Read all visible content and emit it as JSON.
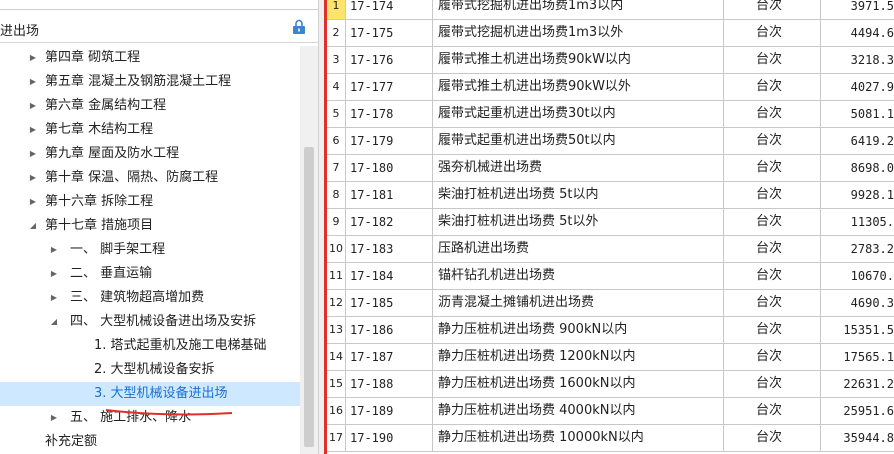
{
  "left_panel": {
    "header_title": "进出场",
    "tree": [
      {
        "label": "第四章 砌筑工程",
        "arrow": "▶"
      },
      {
        "label": "第五章 混凝土及钢筋混凝土工程",
        "arrow": "▶"
      },
      {
        "label": "第六章 金属结构工程",
        "arrow": "▶"
      },
      {
        "label": "第七章 木结构工程",
        "arrow": "▶"
      },
      {
        "label": "第九章 屋面及防水工程",
        "arrow": "▶"
      },
      {
        "label": "第十章 保温、隔热、防腐工程",
        "arrow": "▶"
      },
      {
        "label": "第十六章 拆除工程",
        "arrow": "▶"
      },
      {
        "label": "第十七章 措施项目",
        "arrow": "◢"
      },
      {
        "label": "一、 脚手架工程",
        "arrow": "▶"
      },
      {
        "label": "二、 垂直运输",
        "arrow": "▶"
      },
      {
        "label": "三、 建筑物超高增加费",
        "arrow": "▶"
      },
      {
        "label": "四、 大型机械设备进出场及安拆",
        "arrow": "◢"
      },
      {
        "label": "1. 塔式起重机及施工电梯基础",
        "arrow": ""
      },
      {
        "label": "2. 大型机械设备安拆",
        "arrow": ""
      },
      {
        "label": "3. 大型机械设备进出场",
        "arrow": ""
      },
      {
        "label": "五、 施工排水、降水",
        "arrow": "▶"
      },
      {
        "label": "补充定额",
        "arrow": ""
      }
    ]
  },
  "table": {
    "rows": [
      {
        "idx": "1",
        "code": "17-174",
        "name": "履带式挖掘机进出场费1m3以内",
        "unit": "台次",
        "price": "3971.5"
      },
      {
        "idx": "2",
        "code": "17-175",
        "name": "履带式挖掘机进出场费1m3以外",
        "unit": "台次",
        "price": "4494.6"
      },
      {
        "idx": "3",
        "code": "17-176",
        "name": "履带式推土机进出场费90kW以内",
        "unit": "台次",
        "price": "3218.3"
      },
      {
        "idx": "4",
        "code": "17-177",
        "name": "履带式推土机进出场费90kW以外",
        "unit": "台次",
        "price": "4027.9"
      },
      {
        "idx": "5",
        "code": "17-178",
        "name": "履带式起重机进出场费30t以内",
        "unit": "台次",
        "price": "5081.1"
      },
      {
        "idx": "6",
        "code": "17-179",
        "name": "履带式起重机进出场费50t以内",
        "unit": "台次",
        "price": "6419.2"
      },
      {
        "idx": "7",
        "code": "17-180",
        "name": "强夯机械进出场费",
        "unit": "台次",
        "price": "8698.0"
      },
      {
        "idx": "8",
        "code": "17-181",
        "name": "柴油打桩机进出场费 5t以内",
        "unit": "台次",
        "price": "9928.1"
      },
      {
        "idx": "9",
        "code": "17-182",
        "name": "柴油打桩机进出场费 5t以外",
        "unit": "台次",
        "price": "11305."
      },
      {
        "idx": "10",
        "code": "17-183",
        "name": "压路机进出场费",
        "unit": "台次",
        "price": "2783.2"
      },
      {
        "idx": "11",
        "code": "17-184",
        "name": "锚杆钻孔机进出场费",
        "unit": "台次",
        "price": "10670."
      },
      {
        "idx": "12",
        "code": "17-185",
        "name": "沥青混凝土摊铺机进出场费",
        "unit": "台次",
        "price": "4690.3"
      },
      {
        "idx": "13",
        "code": "17-186",
        "name": "静力压桩机进出场费 900kN以内",
        "unit": "台次",
        "price": "15351.5"
      },
      {
        "idx": "14",
        "code": "17-187",
        "name": "静力压桩机进出场费 1200kN以内",
        "unit": "台次",
        "price": "17565.1"
      },
      {
        "idx": "15",
        "code": "17-188",
        "name": "静力压桩机进出场费 1600kN以内",
        "unit": "台次",
        "price": "22631.2"
      },
      {
        "idx": "16",
        "code": "17-189",
        "name": "静力压桩机进出场费 4000kN以内",
        "unit": "台次",
        "price": "25951.6"
      },
      {
        "idx": "17",
        "code": "17-190",
        "name": "静力压桩机进出场费 10000kN以内",
        "unit": "台次",
        "price": "35944.8"
      }
    ]
  },
  "colors": {
    "selected_bg": "#cde8ff",
    "row_highlight": "#ffe36a",
    "accent_red": "#e0302a",
    "link_blue": "#1a6fcf"
  },
  "icons": {
    "header_action": "lock-icon"
  }
}
